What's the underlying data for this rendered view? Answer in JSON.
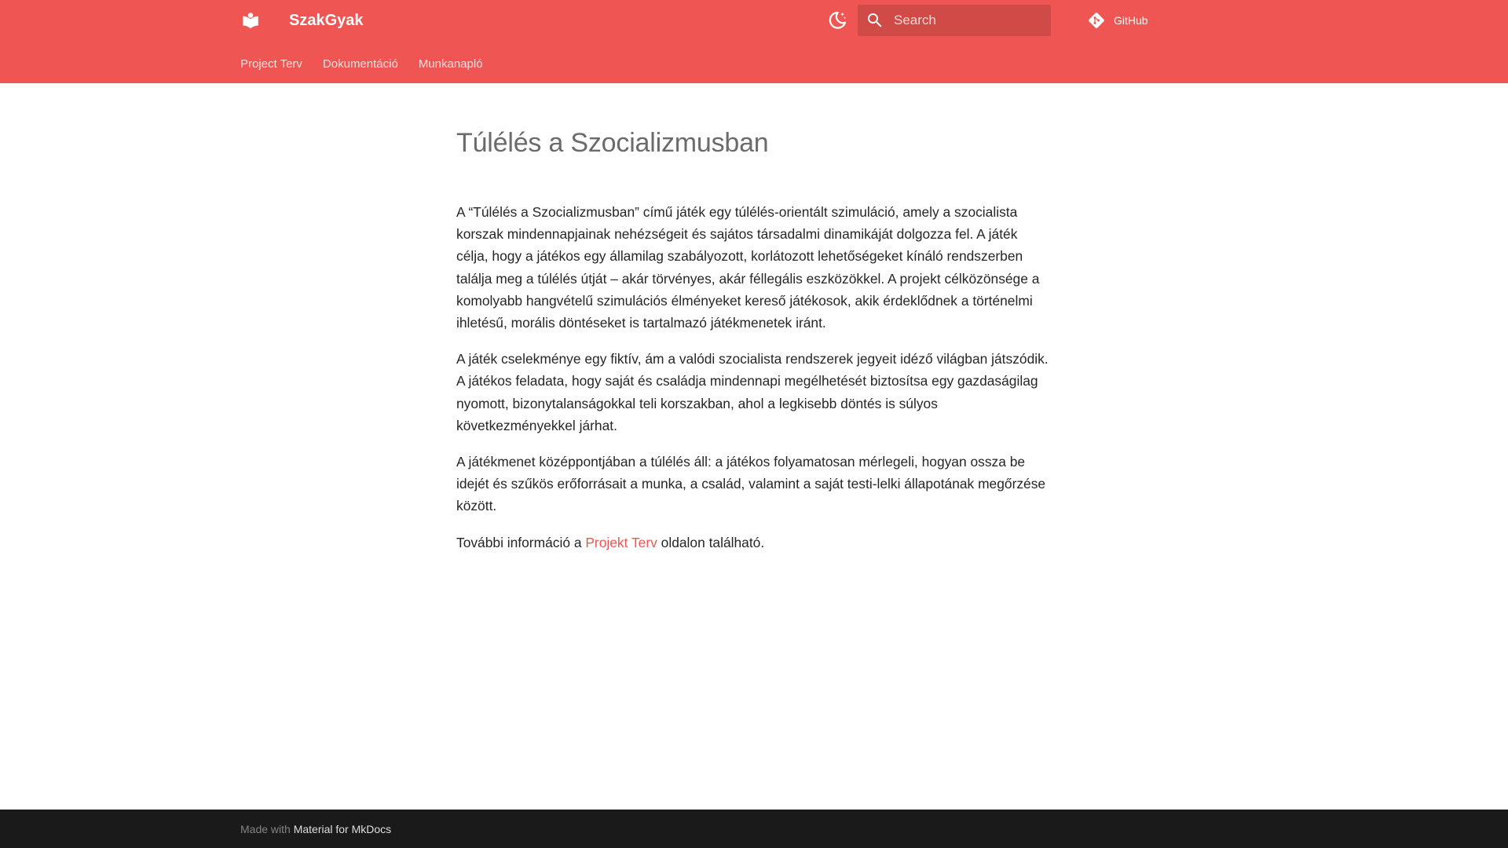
{
  "header": {
    "site_title": "SzakGyak",
    "search": {
      "placeholder": "Search",
      "value": ""
    },
    "repo": {
      "label": "GitHub",
      "icon": "git-icon"
    },
    "logo_icon": "book-open-icon",
    "theme_toggle_icon": "moon-icon",
    "search_icon": "search-icon",
    "tabs": [
      {
        "label": "Project Terv"
      },
      {
        "label": "Dokumentáció"
      },
      {
        "label": "Munkanapló"
      }
    ]
  },
  "main": {
    "title": "Túlélés a Szocializmusban",
    "paragraphs": [
      "A “Túlélés a Szocializmusban” című játék egy túlélés-orientált szimuláció, amely a szocialista korszak mindennapjainak nehézségeit és sajátos társadalmi dinamikáját dolgozza fel. A játék célja, hogy a játékos egy államilag szabályozott, korlátozott lehetőségeket kínáló rendszerben találja meg a túlélés útját – akár törvényes, akár féllegális eszközökkel. A projekt célközönsége a komolyabb hangvételű szimulációs élményeket kereső játékosok, akik érdeklődnek a történelmi ihletésű, morális döntéseket is tartalmazó játékmenetek iránt.",
      "A játék cselekménye egy fiktív, ám a valódi szocialista rendszerek jegyeit idéző világban játszódik. A játékos feladata, hogy saját és családja mindennapi megélhetését biztosítsa egy gazdaságilag nyomott, bizonytalanságokkal teli korszakban, ahol a legkisebb döntés is súlyos következményekkel járhat.",
      "A játékmenet középpontjában a túlélés áll: a játékos folyamatosan mérlegeli, hogyan ossza be idejét és szűkös erőforrásait a munka, a család, valamint a saját testi-lelki állapotának megőrzése között."
    ],
    "more_info": {
      "prefix": "További információ a ",
      "link_label": "Projekt Terv",
      "suffix": " oldalon található."
    }
  },
  "footer": {
    "made_with": "Made with ",
    "link_label": "Material for MkDocs"
  },
  "colors": {
    "primary": "#ef5552",
    "footer_bg": "#1a1a1a",
    "text": "#262626",
    "title": "#6b6b6b"
  }
}
